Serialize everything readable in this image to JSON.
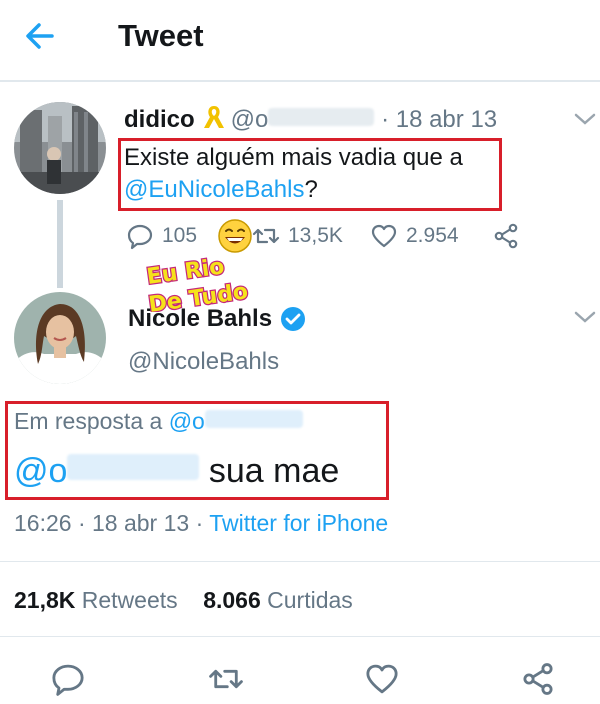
{
  "header": {
    "title": "Tweet"
  },
  "tweet1": {
    "name": "didico",
    "handle_prefix": "@o",
    "date": "· 18 abr 13",
    "text_line1": "Existe alguém mais vadia que a",
    "mention": "@EuNicoleBahls",
    "text_end": "?",
    "reply_count": "105",
    "retweet_count": "13,5K",
    "like_count": "2.954"
  },
  "watermark": {
    "line1": "Eu Rio",
    "line2": "De Tudo"
  },
  "tweet2": {
    "name": "Nicole Bahls",
    "handle": "@NicoleBahls",
    "reply_label": "Em resposta a",
    "reply_handle_prefix": "@o",
    "text_handle_prefix": "@o",
    "text_rest": "sua mae",
    "time": "16:26 · 18 abr 13 ·",
    "source": "Twitter for iPhone",
    "retweets_count": "21,8K",
    "retweets_label": "Retweets",
    "likes_count": "8.066",
    "likes_label": "Curtidas"
  },
  "colors": {
    "accent": "#1da1f2",
    "highlight_box": "#d81f2a",
    "muted": "#657786"
  },
  "icons": [
    "back-arrow-icon",
    "chevron-down-icon",
    "reply-icon",
    "retweet-icon",
    "like-icon",
    "share-icon",
    "verified-icon",
    "ribbon-icon"
  ]
}
